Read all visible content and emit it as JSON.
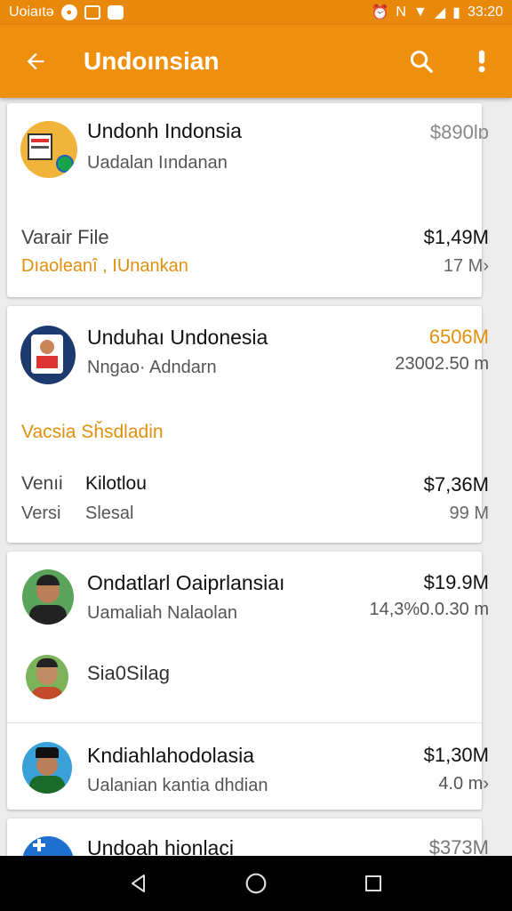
{
  "status_bar": {
    "left_text": "Uoiaıtə",
    "time": "33:20",
    "carrier": "N"
  },
  "app_bar": {
    "title": "Undoınsian",
    "back_icon": "arrow-back-icon",
    "search_icon": "search-icon",
    "menu_icon": "more-vert-icon"
  },
  "cards": [
    {
      "title": "Undonh Indonsia",
      "subtitle": "Uadalan Iındanan",
      "amount": "$890lɒ",
      "row2_label": "Varair File",
      "row2_amount": "$1,49M",
      "row2_sub_label": "Dıaoleanî , IUnankan",
      "row2_sub_value": "17 M›"
    },
    {
      "title": "Unduhaı Undonesia",
      "subtitle": "Nngao· Adndarn",
      "amount": "6506M",
      "time": "23002.50 m",
      "section_label": "Vacsia Sȟsdladin",
      "row1_label": "Venıi",
      "row1_value": "Kilotlou",
      "row1_amount": "$7,36M",
      "row2_label": "Versi",
      "row2_value": "Slesal",
      "row2_amount": "99 M"
    },
    {
      "title": "Ondatlarl Oaiprlansiaı",
      "subtitle": "Uamaliah Nalaolan",
      "amount": "$19.9M",
      "time": "14,3%0.0.30 m",
      "item2_title": "Sia0Silag",
      "item3_title": "Kndiahlahodolasia",
      "item3_subtitle": "Ualanian kantia dhdian",
      "item3_amount": "$1,30M",
      "item3_time": "4.0 m›"
    },
    {
      "title": "Undoah hionlaci",
      "amount": "$373M"
    }
  ],
  "colors": {
    "accent": "#ef8f0e",
    "accent_text": "#e0900e"
  },
  "nav": {
    "back": "back-triangle-icon",
    "home": "home-circle-icon",
    "recents": "recents-square-icon"
  }
}
